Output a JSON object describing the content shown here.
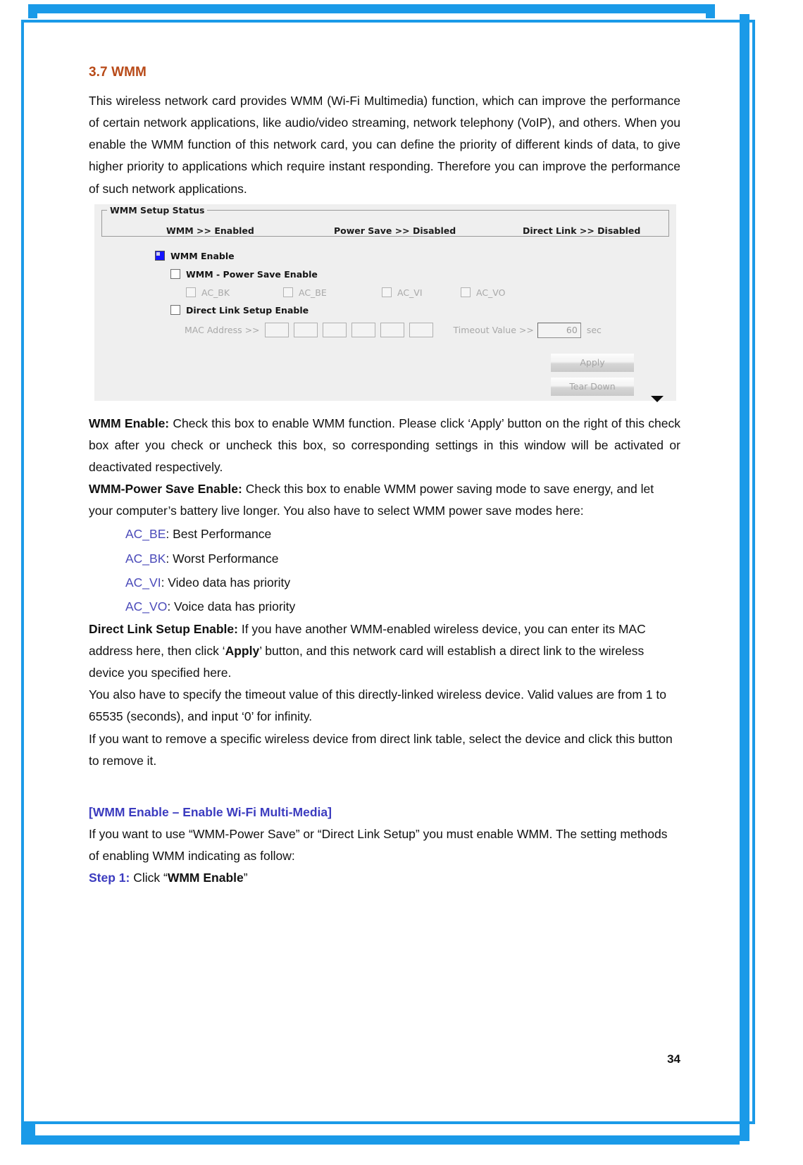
{
  "section": {
    "heading": "3.7 WMM",
    "intro": "This wireless network card provides WMM (Wi-Fi Multimedia) function, which can improve the performance of certain network applications, like audio/video streaming, network telephony (VoIP), and others. When you enable the WMM function of this network card, you can define the priority of different kinds of data, to give higher priority to applications which require instant responding. Therefore you can improve the performance of such network applications."
  },
  "wmm_panel": {
    "groupbox_title": "WMM Setup Status",
    "status": {
      "wmm": "WMM >>  Enabled",
      "power_save": "Power Save >>  Disabled",
      "direct_link": "Direct Link >>  Disabled"
    },
    "checkboxes": {
      "wmm_enable": "WMM Enable",
      "power_save_enable": "WMM - Power Save Enable",
      "direct_link_enable": "Direct Link Setup Enable"
    },
    "ac_options": [
      "AC_BK",
      "AC_BE",
      "AC_VI",
      "AC_VO"
    ],
    "mac_address_label": "MAC Address >>",
    "mac_cells": [
      "",
      "",
      "",
      "",
      "",
      ""
    ],
    "timeout_label": "Timeout Value >>",
    "timeout_value": "60",
    "timeout_unit": "sec",
    "buttons": {
      "apply": "Apply",
      "tear_down": "Tear Down"
    }
  },
  "descriptions": {
    "wmm_enable_term": "WMM Enable:",
    "wmm_enable_text": " Check this box to enable WMM function. Please click ‘Apply’ button on the right of this check box after you check or uncheck this box, so corresponding settings in this window will be activated or deactivated respectively.",
    "power_save_term": "WMM-Power Save Enable:",
    "power_save_text": " Check this box to enable WMM power saving mode to save energy, and let your computer’s battery live longer. You also have to select WMM power save modes here:",
    "ac_list": [
      {
        "code": "AC_BE",
        "desc": ": Best Performance"
      },
      {
        "code": "AC_BK",
        "desc": ": Worst Performance"
      },
      {
        "code": "AC_VI",
        "desc": ": Video data has priority"
      },
      {
        "code": "AC_VO",
        "desc": ": Voice data has priority"
      }
    ],
    "direct_link_term": "Direct Link Setup Enable:",
    "direct_link_text_1": " If you have another WMM-enabled wireless device, you can enter its MAC address here, then click ‘",
    "direct_link_apply": "Apply",
    "direct_link_text_2": "’ button, and this network card will establish a direct link to the wireless device you specified here.",
    "timeout_paragraph": "You also have to specify the timeout value of this directly-linked wireless device. Valid values are from 1 to 65535 (seconds), and input ‘0’ for infinity.",
    "remove_paragraph": "If you want to remove a specific wireless device from direct link table, select the device and click this button to remove it."
  },
  "wmm_enable_block": {
    "heading": "[WMM Enable – Enable Wi-Fi Multi-Media]",
    "intro": "If you want to use “WMM-Power Save” or “Direct Link Setup” you must enable WMM. The setting methods of enabling WMM indicating as follow:",
    "step_label": "Step 1:",
    "step_text_pre": " Click “",
    "step_text_bold": "WMM Enable",
    "step_text_post": "”"
  },
  "footer": {
    "page_number": "34"
  },
  "colors": {
    "heading": "#b84a18",
    "blue_accent": "#3b3bbf",
    "ac_code": "#4a4ab9",
    "border_blue": "#1a9ae8"
  }
}
